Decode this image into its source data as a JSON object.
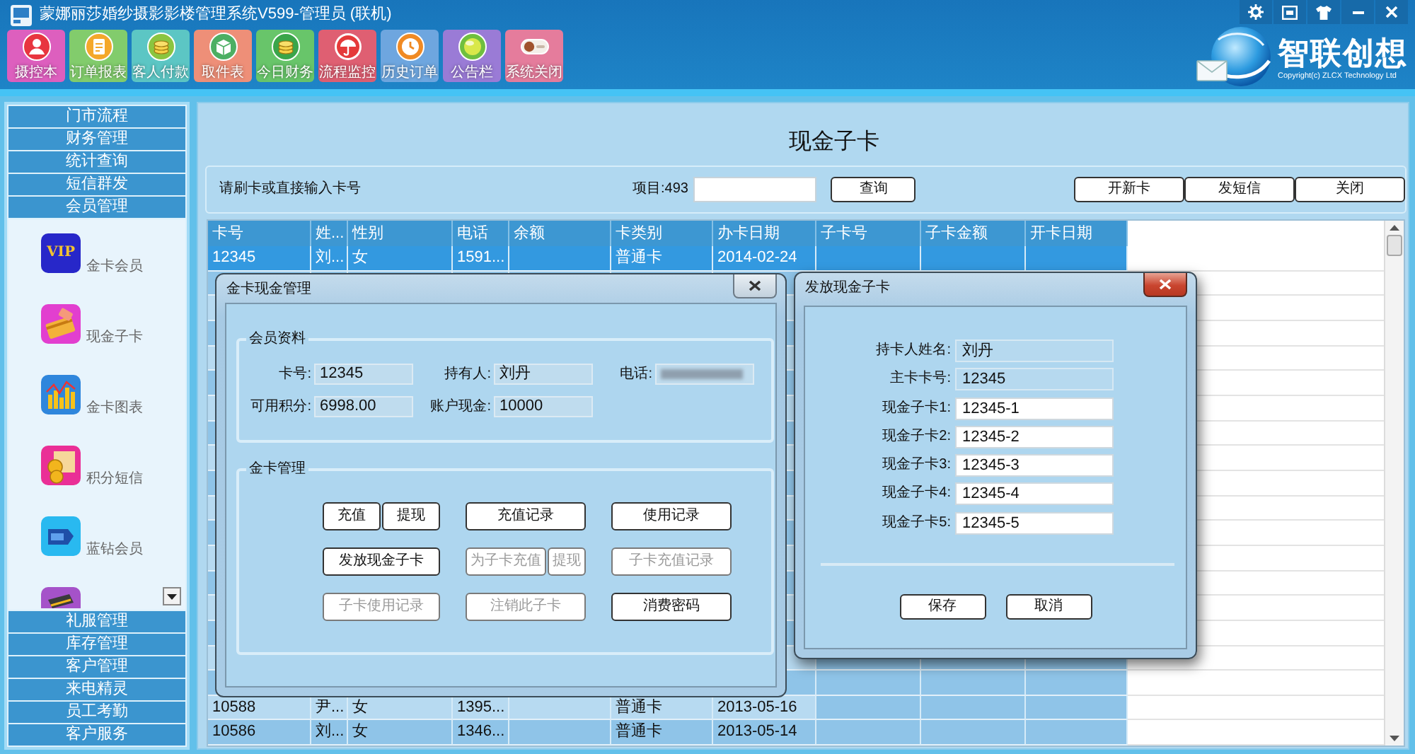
{
  "window": {
    "title": "蒙娜丽莎婚纱摄影影楼管理系统V599-管理员 (联机)"
  },
  "toolbar": [
    {
      "label": "摄控本",
      "color": "#dd5fbe"
    },
    {
      "label": "订单报表",
      "color": "#82cc6c"
    },
    {
      "label": "客人付款",
      "color": "#5cc6c4"
    },
    {
      "label": "取件表",
      "color": "#ee8f78"
    },
    {
      "label": "今日财务",
      "color": "#68c56a"
    },
    {
      "label": "流程监控",
      "color": "#df5f72"
    },
    {
      "label": "历史订单",
      "color": "#6ea6df"
    },
    {
      "label": "公告栏",
      "color": "#9a7bd6"
    },
    {
      "label": "系统关闭",
      "color": "#e57c9c"
    }
  ],
  "logo": {
    "name": "智联创想",
    "copyright": "Copyright(c) ZLCX Technology Ltd"
  },
  "sidebar": {
    "sections": [
      {
        "label": "门市流程"
      },
      {
        "label": "财务管理"
      },
      {
        "label": "统计查询"
      },
      {
        "label": "短信群发"
      },
      {
        "label": "会员管理",
        "items": [
          {
            "label": "金卡会员",
            "icon_text": "VIP"
          },
          {
            "label": "现金子卡"
          },
          {
            "label": "金卡图表"
          },
          {
            "label": "积分短信"
          },
          {
            "label": "蓝钻会员"
          }
        ]
      },
      {
        "label": "礼服管理"
      },
      {
        "label": "库存管理"
      },
      {
        "label": "客户管理"
      },
      {
        "label": "来电精灵"
      },
      {
        "label": "员工考勤"
      },
      {
        "label": "客户服务"
      }
    ]
  },
  "page": {
    "title": "现金子卡",
    "prompt": "请刷卡或直接输入卡号",
    "count": "项目:493",
    "search_button": "查询",
    "actions": [
      "开新卡",
      "发短信",
      "关闭"
    ]
  },
  "table": {
    "columns": [
      "卡号",
      "姓...",
      "性别",
      "电话",
      "余额",
      "卡类别",
      "办卡日期",
      "子卡号",
      "子卡金额",
      "开卡日期"
    ],
    "rows": [
      {
        "selected": true,
        "cells": [
          "12345",
          "刘...",
          "女",
          "1591...",
          null,
          "普通卡",
          "2014-02-24",
          null,
          null,
          null
        ]
      },
      {
        "selected": false
      },
      {
        "selected": false
      },
      {
        "selected": false
      },
      {
        "selected": false
      },
      {
        "selected": false
      },
      {
        "selected": false
      },
      {
        "selected": false
      },
      {
        "selected": false
      },
      {
        "selected": false
      },
      {
        "selected": false
      },
      {
        "selected": false
      },
      {
        "selected": false
      },
      {
        "selected": false
      },
      {
        "selected": false
      },
      {
        "selected": false
      },
      {
        "selected": false
      },
      {
        "selected": false
      },
      {
        "selected": false,
        "cells": [
          "10588",
          "尹...",
          "女",
          "1395...",
          null,
          "普通卡",
          "2013-05-16",
          null,
          null,
          null
        ]
      },
      {
        "selected": false,
        "cells": [
          "10586",
          "刘...",
          "女",
          "1346...",
          null,
          "普通卡",
          "2013-05-14",
          null,
          null,
          null
        ]
      }
    ]
  },
  "card_cash_dialog": {
    "title": "金卡现金管理",
    "active": false,
    "member_info": {
      "legend": "会员资料",
      "fields": [
        {
          "label": "卡号:",
          "value": "12345",
          "blurred": false
        },
        {
          "label": "持有人:",
          "value": "刘丹",
          "blurred": false
        },
        {
          "label": "电话:",
          "blurred": true
        },
        {
          "label": "可用积分:",
          "value": "6998.00",
          "blurred": false
        },
        {
          "label": "账户现金:",
          "value": "10000",
          "blurred": false
        }
      ]
    },
    "card_management": {
      "legend": "金卡管理",
      "button_rows": [
        [
          [
            {
              "label": "充值",
              "disabled": false
            },
            {
              "label": "提现",
              "disabled": false
            }
          ],
          [
            {
              "label": "充值记录",
              "disabled": false
            }
          ],
          [
            {
              "label": "使用记录",
              "disabled": false
            }
          ]
        ],
        [
          [
            {
              "label": "发放现金子卡",
              "disabled": false
            }
          ],
          [
            {
              "label": "为子卡充值",
              "disabled": true
            },
            {
              "label": "提现",
              "disabled": true
            }
          ],
          [
            {
              "label": "子卡充值记录",
              "disabled": true
            }
          ]
        ],
        [
          [
            {
              "label": "子卡使用记录",
              "disabled": true
            }
          ],
          [
            {
              "label": "注销此子卡",
              "disabled": true
            }
          ],
          [
            {
              "label": "消费密码",
              "disabled": false
            }
          ]
        ]
      ]
    }
  },
  "issue_subcard_dialog": {
    "title": "发放现金子卡",
    "active": true,
    "fields": [
      {
        "label": "持卡人姓名:",
        "value": "刘丹",
        "readonly": true
      },
      {
        "label": "主卡卡号:",
        "value": "12345",
        "readonly": true
      },
      {
        "label": "现金子卡1:",
        "value": "12345-1",
        "readonly": false
      },
      {
        "label": "现金子卡2:",
        "value": "12345-2",
        "readonly": false
      },
      {
        "label": "现金子卡3:",
        "value": "12345-3",
        "readonly": false
      },
      {
        "label": "现金子卡4:",
        "value": "12345-4",
        "readonly": false
      },
      {
        "label": "现金子卡5:",
        "value": "12345-5",
        "readonly": false
      }
    ],
    "buttons": [
      "保存",
      "取消"
    ]
  }
}
